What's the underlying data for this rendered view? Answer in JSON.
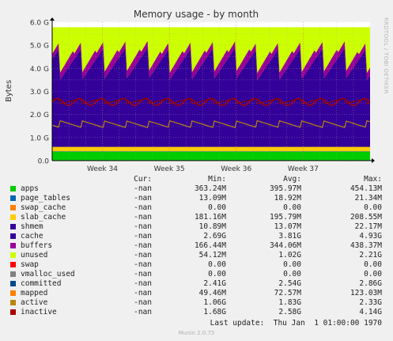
{
  "chart_data": {
    "type": "area",
    "title": "Memory usage - by month",
    "ylabel": "Bytes",
    "xlabel": "",
    "ylim": [
      0,
      6.0
    ],
    "y_unit": "G",
    "y_ticks": [
      "0.0",
      "1.0 G",
      "2.0 G",
      "3.0 G",
      "4.0 G",
      "5.0 G",
      "6.0 G"
    ],
    "x_range_weeks": [
      33.25,
      38.0
    ],
    "x_ticks": [
      {
        "label": "Week 34",
        "week": 34
      },
      {
        "label": "Week 35",
        "week": 35
      },
      {
        "label": "Week 36",
        "week": 36
      },
      {
        "label": "Week 37",
        "week": 37
      }
    ],
    "grid": true,
    "background_color": "#f0f0f0",
    "plot_bg": "#ffffff",
    "stacked_series": [
      {
        "name": "apps",
        "color": "#00cc00",
        "level": 0.38
      },
      {
        "name": "page_tables",
        "color": "#0066b3",
        "level": 0.02
      },
      {
        "name": "swap_cache",
        "color": "#ff8000",
        "level": 0.0
      },
      {
        "name": "slab_cache",
        "color": "#ffcc00",
        "level": 0.19
      },
      {
        "name": "shmem",
        "color": "#330099",
        "level": 0.01
      },
      {
        "name": "cache",
        "color": "#330099",
        "range": [
          2.69,
          4.93
        ]
      },
      {
        "name": "buffers",
        "color": "#990099",
        "range": [
          0.17,
          0.44
        ]
      },
      {
        "name": "unused",
        "color": "#ccff00",
        "top": 5.78
      }
    ],
    "line_series": [
      {
        "name": "committed",
        "color": "#aa0000",
        "level": 2.54
      },
      {
        "name": "active",
        "color": "#b8860b",
        "level": 1.83
      },
      {
        "name": "inactive",
        "color": "#aa0000",
        "level": 2.58
      }
    ],
    "legend_rows": [
      {
        "name": "apps",
        "color": "#00cc00",
        "cur": "-nan",
        "min": "363.24M",
        "avg": "395.97M",
        "max": "454.13M"
      },
      {
        "name": "page_tables",
        "color": "#0066b3",
        "cur": "-nan",
        "min": "13.09M",
        "avg": "18.92M",
        "max": "21.34M"
      },
      {
        "name": "swap_cache",
        "color": "#ff8000",
        "cur": "-nan",
        "min": "0.00",
        "avg": "0.00",
        "max": "0.00"
      },
      {
        "name": "slab_cache",
        "color": "#ffcc00",
        "cur": "-nan",
        "min": "181.16M",
        "avg": "195.79M",
        "max": "208.55M"
      },
      {
        "name": "shmem",
        "color": "#330099",
        "cur": "-nan",
        "min": "10.89M",
        "avg": "13.07M",
        "max": "22.17M"
      },
      {
        "name": "cache",
        "color": "#330099",
        "cur": "-nan",
        "min": "2.69G",
        "avg": "3.81G",
        "max": "4.93G"
      },
      {
        "name": "buffers",
        "color": "#990099",
        "cur": "-nan",
        "min": "166.44M",
        "avg": "344.06M",
        "max": "438.37M"
      },
      {
        "name": "unused",
        "color": "#ccff00",
        "cur": "-nan",
        "min": "54.12M",
        "avg": "1.02G",
        "max": "2.21G"
      },
      {
        "name": "swap",
        "color": "#ff0000",
        "cur": "-nan",
        "min": "0.00",
        "avg": "0.00",
        "max": "0.00"
      },
      {
        "name": "vmalloc_used",
        "color": "#808080",
        "cur": "-nan",
        "min": "0.00",
        "avg": "0.00",
        "max": "0.00"
      },
      {
        "name": "committed",
        "color": "#004b8a",
        "cur": "-nan",
        "min": "2.41G",
        "avg": "2.54G",
        "max": "2.86G"
      },
      {
        "name": "mapped",
        "color": "#ff8000",
        "cur": "-nan",
        "min": "49.46M",
        "avg": "72.57M",
        "max": "123.03M"
      },
      {
        "name": "active",
        "color": "#b8860b",
        "cur": "-nan",
        "min": "1.06G",
        "avg": "1.83G",
        "max": "2.33G"
      },
      {
        "name": "inactive",
        "color": "#aa0000",
        "cur": "-nan",
        "min": "1.68G",
        "avg": "2.58G",
        "max": "4.14G"
      }
    ]
  },
  "legend_header": {
    "cur": "Cur:",
    "min": "Min:",
    "avg": "Avg:",
    "max": "Max:"
  },
  "last_update": "Last update:  Thu Jan  1 01:00:00 1970",
  "footer": "Munin 2.0.75",
  "watermark": "RRDTOOL / TOBI OETIKER"
}
